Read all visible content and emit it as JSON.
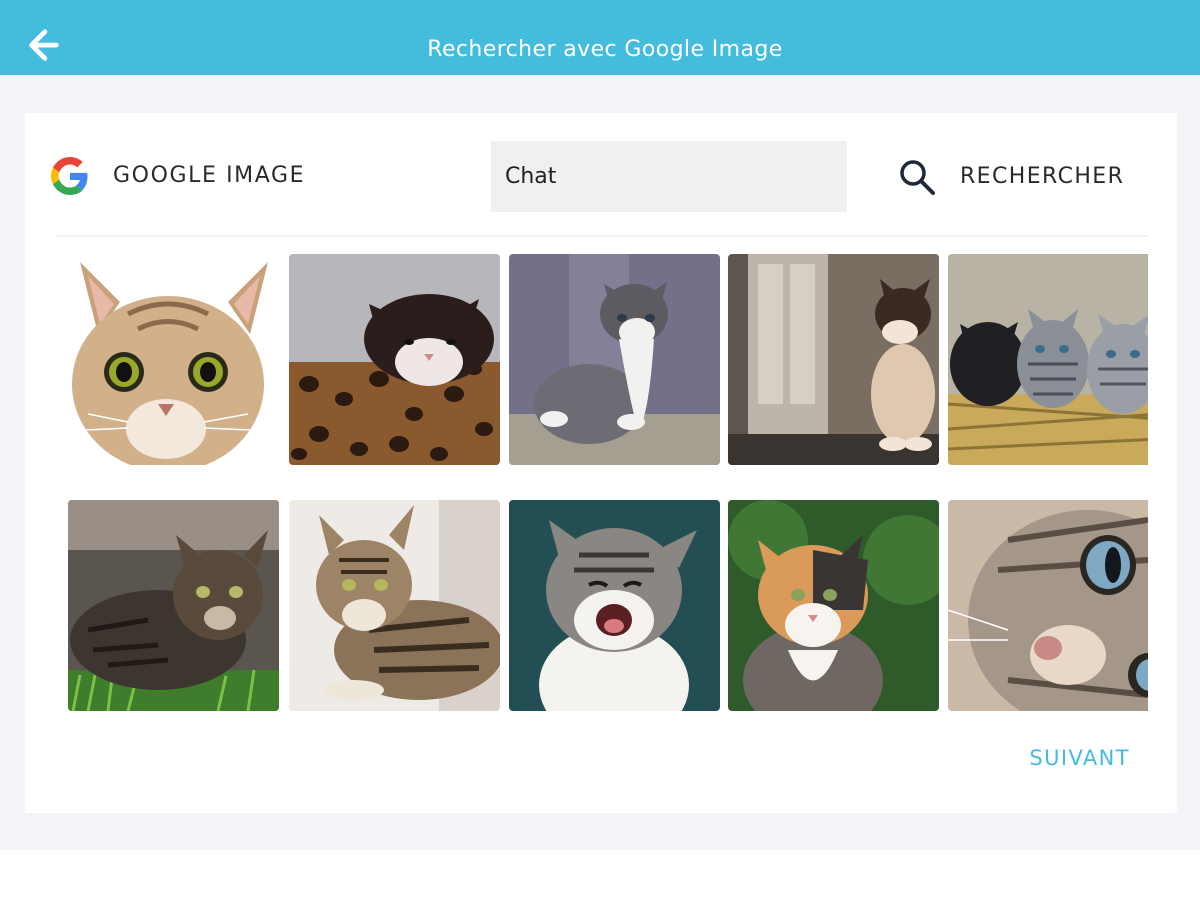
{
  "header": {
    "title": "Rechercher avec Google Image",
    "back_icon": "arrow-left-icon",
    "background_color": "#44bcde"
  },
  "search_panel": {
    "brand_icon": "google-g-icon",
    "brand_label": "GOOGLE IMAGE",
    "query_value": "Chat",
    "search_icon": "magnifier-icon",
    "search_label": "RECHERCHER"
  },
  "results": {
    "icon": "cat-photo",
    "count": 10,
    "images": [
      {
        "subject": "tabby-cat-face"
      },
      {
        "subject": "black-white-kitten-on-leopard-box"
      },
      {
        "subject": "grey-white-kitten-sitting"
      },
      {
        "subject": "kitten-by-window"
      },
      {
        "subject": "three-kittens-on-hay"
      },
      {
        "subject": "tabby-cat-in-grass"
      },
      {
        "subject": "tabby-cat-lying"
      },
      {
        "subject": "meowing-kitten"
      },
      {
        "subject": "calico-cat"
      },
      {
        "subject": "cat-close-up-blue-eye"
      }
    ]
  },
  "footer": {
    "next_label": "SUIVANT",
    "accent_color": "#44bcde"
  }
}
